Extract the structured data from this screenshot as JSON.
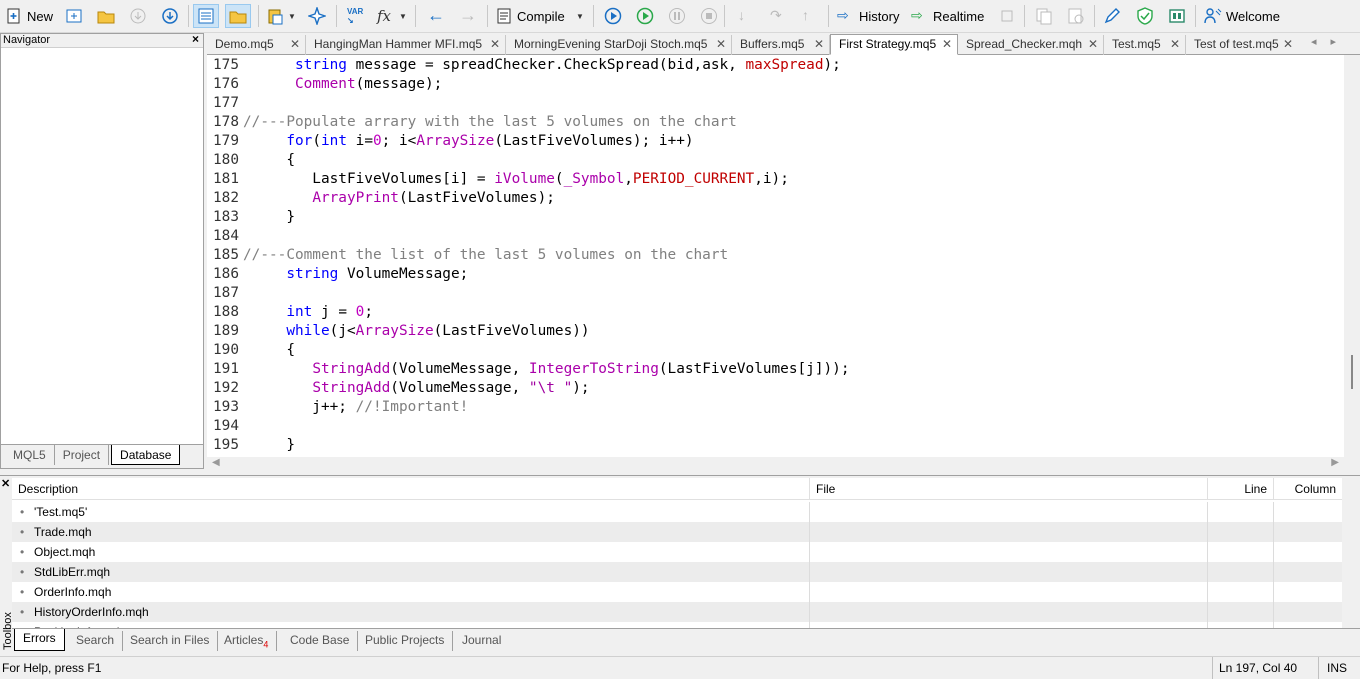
{
  "toolbar": {
    "new_label": "New",
    "compile_label": "Compile",
    "history_label": "History",
    "realtime_label": "Realtime",
    "welcome_label": "Welcome",
    "var_label": "VAR",
    "fx_label": "fx"
  },
  "navigator": {
    "title": "Navigator",
    "tabs": [
      "MQL5",
      "Project",
      "Database"
    ],
    "active_tab": "Database"
  },
  "file_tabs": [
    "Demo.mq5",
    "HangingMan Hammer MFI.mq5",
    "MorningEvening StarDoji Stoch.mq5",
    "Buffers.mq5",
    "First Strategy.mq5",
    "Spread_Checker.mqh",
    "Test.mq5",
    "Test of test.mq5"
  ],
  "active_file_tab": "First Strategy.mq5",
  "code": {
    "lines": [
      {
        "n": "175",
        "t": [
          [
            "",
            "      "
          ],
          [
            "kw",
            "string"
          ],
          [
            "",
            " message = spreadChecker.CheckSpread(bid,ask, "
          ],
          [
            "cst",
            "maxSpread"
          ],
          [
            "",
            ");"
          ]
        ]
      },
      {
        "n": "176",
        "t": [
          [
            "",
            "      "
          ],
          [
            "fn",
            "Comment"
          ],
          [
            "",
            "(message);"
          ]
        ]
      },
      {
        "n": "177",
        "t": []
      },
      {
        "n": "178",
        "t": [
          [
            "cm",
            "//---Populate arrary with the last 5 volumes on the chart"
          ]
        ]
      },
      {
        "n": "179",
        "t": [
          [
            "",
            "     "
          ],
          [
            "kw",
            "for"
          ],
          [
            "",
            "("
          ],
          [
            "kw",
            "int"
          ],
          [
            "",
            " i="
          ],
          [
            "nm",
            "0"
          ],
          [
            "",
            "; i<"
          ],
          [
            "fn",
            "ArraySize"
          ],
          [
            "",
            "(LastFiveVolumes); i++)"
          ]
        ]
      },
      {
        "n": "180",
        "t": [
          [
            "",
            "     {"
          ]
        ]
      },
      {
        "n": "181",
        "t": [
          [
            "",
            "        LastFiveVolumes[i] = "
          ],
          [
            "fn",
            "iVolume"
          ],
          [
            "",
            "("
          ],
          [
            "fn",
            "_Symbol"
          ],
          [
            "",
            ","
          ],
          [
            "cst",
            "PERIOD_CURRENT"
          ],
          [
            "",
            ",i);"
          ]
        ]
      },
      {
        "n": "182",
        "t": [
          [
            "",
            "        "
          ],
          [
            "fn",
            "ArrayPrint"
          ],
          [
            "",
            "(LastFiveVolumes);"
          ]
        ]
      },
      {
        "n": "183",
        "t": [
          [
            "",
            "     }"
          ]
        ]
      },
      {
        "n": "184",
        "t": []
      },
      {
        "n": "185",
        "t": [
          [
            "cm",
            "//---Comment the list of the last 5 volumes on the chart"
          ]
        ]
      },
      {
        "n": "186",
        "t": [
          [
            "",
            "     "
          ],
          [
            "kw",
            "string"
          ],
          [
            "",
            " VolumeMessage;"
          ]
        ]
      },
      {
        "n": "187",
        "t": []
      },
      {
        "n": "188",
        "t": [
          [
            "",
            "     "
          ],
          [
            "kw",
            "int"
          ],
          [
            "",
            " j = "
          ],
          [
            "nm",
            "0"
          ],
          [
            "",
            ";"
          ]
        ]
      },
      {
        "n": "189",
        "t": [
          [
            "",
            "     "
          ],
          [
            "kw",
            "while"
          ],
          [
            "",
            "(j<"
          ],
          [
            "fn",
            "ArraySize"
          ],
          [
            "",
            "(LastFiveVolumes))"
          ]
        ]
      },
      {
        "n": "190",
        "t": [
          [
            "",
            "     {"
          ]
        ]
      },
      {
        "n": "191",
        "t": [
          [
            "",
            "        "
          ],
          [
            "fn",
            "StringAdd"
          ],
          [
            "",
            "(VolumeMessage, "
          ],
          [
            "fn",
            "IntegerToString"
          ],
          [
            "",
            "(LastFiveVolumes[j]));"
          ]
        ]
      },
      {
        "n": "192",
        "t": [
          [
            "",
            "        "
          ],
          [
            "fn",
            "StringAdd"
          ],
          [
            "",
            "(VolumeMessage, "
          ],
          [
            "str",
            "\"\\t \""
          ],
          [
            "",
            ");"
          ]
        ]
      },
      {
        "n": "193",
        "t": [
          [
            "",
            "        j++; "
          ],
          [
            "cm",
            "//!Important!"
          ]
        ]
      },
      {
        "n": "194",
        "t": []
      },
      {
        "n": "195",
        "t": [
          [
            "",
            "     }"
          ]
        ]
      }
    ]
  },
  "toolbox": {
    "label": "Toolbox",
    "columns": [
      "Description",
      "File",
      "Line",
      "Column"
    ],
    "rows": [
      "'Test.mq5'",
      "Trade.mqh",
      "Object.mqh",
      "StdLibErr.mqh",
      "OrderInfo.mqh",
      "HistoryOrderInfo.mqh",
      "PositionInfo.mqh"
    ],
    "tabs": [
      "Errors",
      "Search",
      "Search in Files",
      "Articles",
      "Code Base",
      "Public Projects",
      "Journal"
    ],
    "articles_badge": "4",
    "active_tab": "Errors"
  },
  "status": {
    "help": "For Help, press F1",
    "position": "Ln 197, Col 40",
    "mode": "INS"
  },
  "colors": {
    "keyword": "#0000ff",
    "function": "#aa00aa",
    "comment": "#808080",
    "constant": "#c00000"
  }
}
